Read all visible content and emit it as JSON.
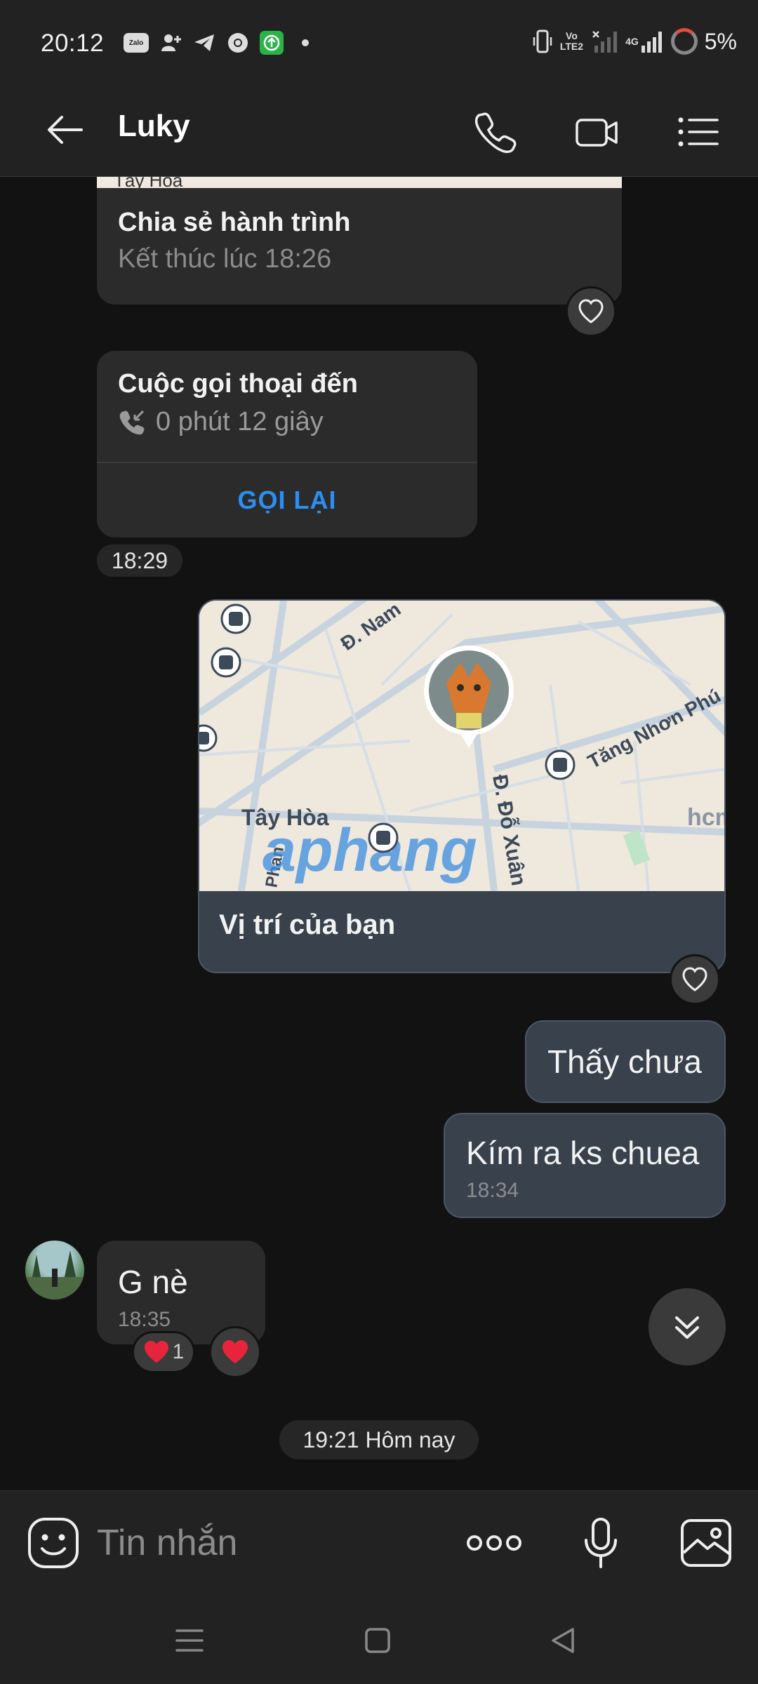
{
  "status_bar": {
    "time": "20:12",
    "zalo_label": "Zalo",
    "volte_label": "Vo\nLTE2",
    "network_label": "4G",
    "battery": "5%"
  },
  "header": {
    "title": "Luky"
  },
  "messages": {
    "journey": {
      "map_text": "Tây Hòa",
      "title": "Chia sẻ hành trình",
      "subtitle": "Kết thúc lúc 18:26"
    },
    "call": {
      "title": "Cuộc gọi thoại đến",
      "duration": "0 phút 12 giây",
      "callback_label": "GỌI LẠI",
      "time": "18:29"
    },
    "location": {
      "label": "Vị trí của bạn",
      "map_labels": {
        "street_nam": "Đ. Nam",
        "street_tang": "Tăng Nhơn Phú",
        "area_tayhoa": "Tây Hòa",
        "street_doxuan": "Đ. Đỗ Xuân",
        "street_phan": "Phan",
        "hcm": "hcm",
        "watermark": "aphang"
      }
    },
    "out1": {
      "text": "Thấy chưa"
    },
    "out2": {
      "text": "Kím ra ks chuea",
      "time": "18:34"
    },
    "in1": {
      "text": "G nè",
      "time": "18:35",
      "reaction_count": "1"
    },
    "date_divider": "19:21 Hôm nay"
  },
  "composer": {
    "placeholder": "Tin nhắn"
  },
  "colors": {
    "accent_blue": "#2c8ef0",
    "heart_red": "#e8243c",
    "outgoing_bubble": "#39414d"
  }
}
